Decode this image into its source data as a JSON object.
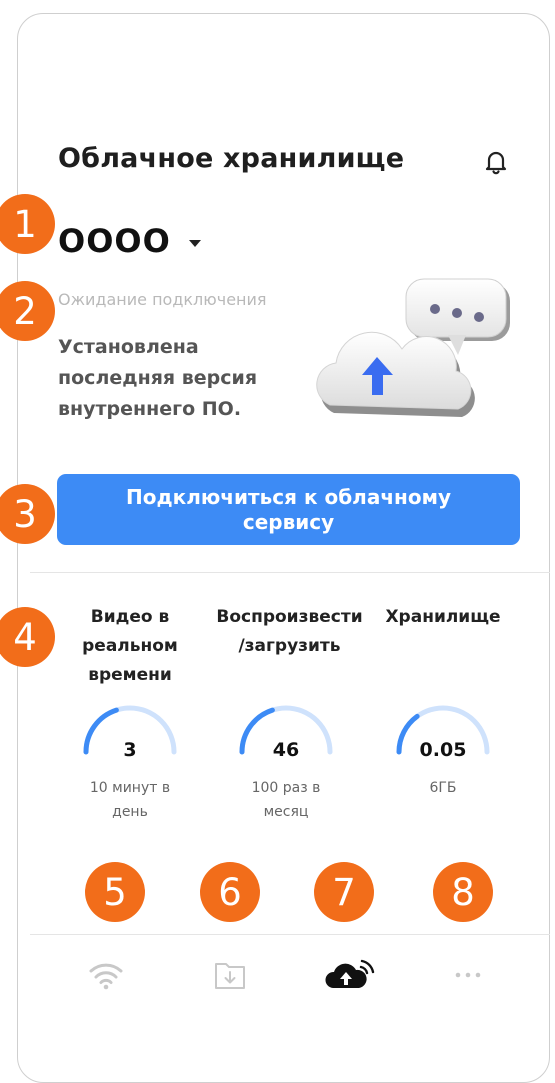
{
  "header": {
    "title": "Облачное хранилище"
  },
  "device": {
    "name": "OOOO"
  },
  "status": {
    "waiting": "Ожидание подключения",
    "firmware": "Установлена последняя версия внутреннего ПО."
  },
  "connect_button": {
    "label": "Подключиться к облачному сервису"
  },
  "stats": [
    {
      "label": "Видео в реальном времени",
      "value": "3",
      "sub": "10 минут в день",
      "fraction": 0.4
    },
    {
      "label": "Воспроизвести /загрузить",
      "value": "46",
      "sub": "100 раз в месяц",
      "fraction": 0.4
    },
    {
      "label": "Хранилище",
      "value": "0.05",
      "sub": "6ГБ",
      "fraction": 0.3
    }
  ],
  "badges": [
    "1",
    "2",
    "3",
    "4",
    "5",
    "6",
    "7",
    "8"
  ],
  "nav": [
    "wifi-icon",
    "download-icon",
    "cloud-upload-icon",
    "more-icon"
  ],
  "colors": {
    "accent": "#3d8bf5",
    "badge": "#f26d1a",
    "gauge_track": "#cfe2fc",
    "gauge_fill": "#3d8bf5"
  }
}
